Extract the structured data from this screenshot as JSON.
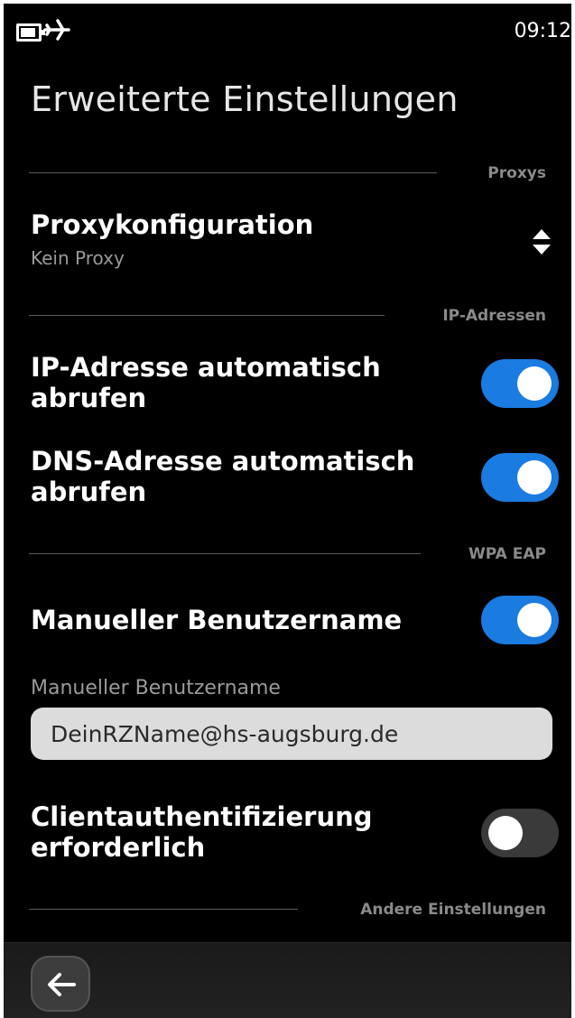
{
  "status_bar": {
    "time": "09:12",
    "icons": [
      "battery-icon",
      "airplane-icon"
    ]
  },
  "page": {
    "title": "Erweiterte Einstellungen"
  },
  "sections": {
    "proxys": "Proxys",
    "ip_addresses": "IP-Adressen",
    "wpa_eap": "WPA EAP",
    "other": "Andere Einstellungen"
  },
  "proxy": {
    "title": "Proxykonfiguration",
    "value": "Kein Proxy",
    "icon": "up-down-arrows-icon"
  },
  "ip_auto": {
    "label_line1": "IP-Adresse automatisch",
    "label_line2": "abrufen",
    "enabled": true
  },
  "dns_auto": {
    "label_line1": "DNS-Adresse automatisch",
    "label_line2": "abrufen",
    "enabled": true
  },
  "manual_username": {
    "label": "Manueller Benutzername",
    "enabled": true
  },
  "username_field": {
    "label": "Manueller Benutzername",
    "value": "DeinRZName@hs-augsburg.de"
  },
  "client_auth": {
    "label_line1": "Clientauthentifizierung",
    "label_line2": "erforderlich",
    "enabled": false
  },
  "toolbar": {
    "back_icon": "back-arrow-icon"
  },
  "colors": {
    "background": "#000000",
    "accent": "#1a7be0",
    "toggle_off": "#3a3a3a",
    "section_label": "#8a8a8a",
    "input_bg": "#dcdcdc"
  }
}
